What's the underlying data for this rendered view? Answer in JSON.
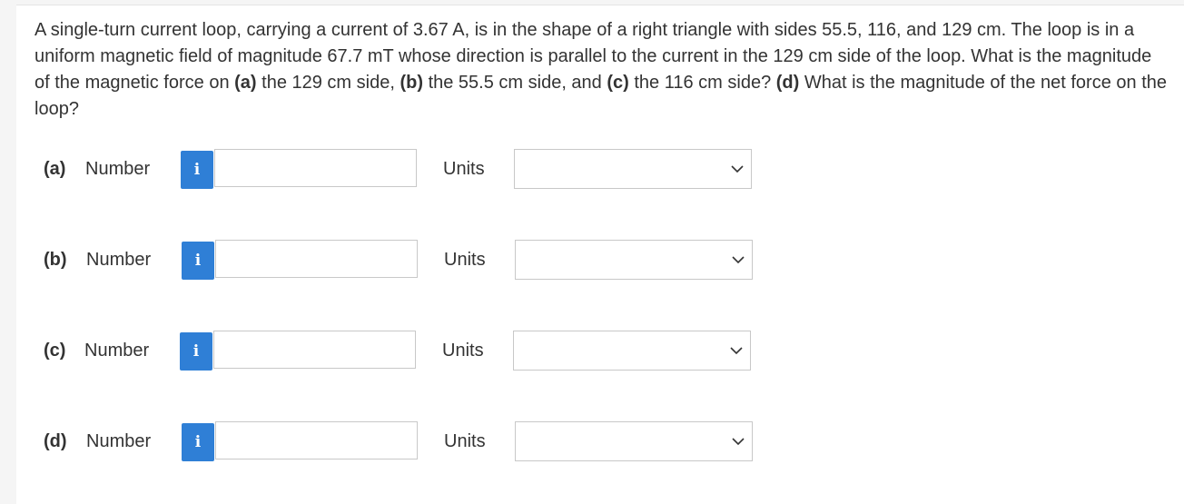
{
  "question": {
    "segments": [
      {
        "text": "A single-turn current loop, carrying a current of 3.67 A, is in the shape of a right triangle with sides 55.5, 116, and 129 cm. The loop is in a uniform magnetic field of magnitude 67.7 mT whose direction is parallel to the current in the 129 cm side of the loop. What is the magnitude of the magnetic force on ",
        "bold": false
      },
      {
        "text": "(a)",
        "bold": true
      },
      {
        "text": " the 129 cm side, ",
        "bold": false
      },
      {
        "text": "(b)",
        "bold": true
      },
      {
        "text": " the 55.5 cm side, and ",
        "bold": false
      },
      {
        "text": "(c)",
        "bold": true
      },
      {
        "text": " the 116 cm side? ",
        "bold": false
      },
      {
        "text": "(d)",
        "bold": true
      },
      {
        "text": " What is the magnitude of the net force on the loop?",
        "bold": false
      }
    ]
  },
  "answers": [
    {
      "part": "(a)",
      "number_label": "Number",
      "info_icon": "info-icon",
      "info_glyph": "i",
      "value": "",
      "units_label": "Units",
      "units_value": ""
    },
    {
      "part": "(b)",
      "number_label": "Number",
      "info_icon": "info-icon",
      "info_glyph": "i",
      "value": "",
      "units_label": "Units",
      "units_value": ""
    },
    {
      "part": "(c)",
      "number_label": "Number",
      "info_icon": "info-icon",
      "info_glyph": "i",
      "value": "",
      "units_label": "Units",
      "units_value": ""
    },
    {
      "part": "(d)",
      "number_label": "Number",
      "info_icon": "info-icon",
      "info_glyph": "i",
      "value": "",
      "units_label": "Units",
      "units_value": ""
    }
  ],
  "colors": {
    "info_button": "#2f7fd6",
    "text": "#333333",
    "border": "#c8c8c8"
  }
}
